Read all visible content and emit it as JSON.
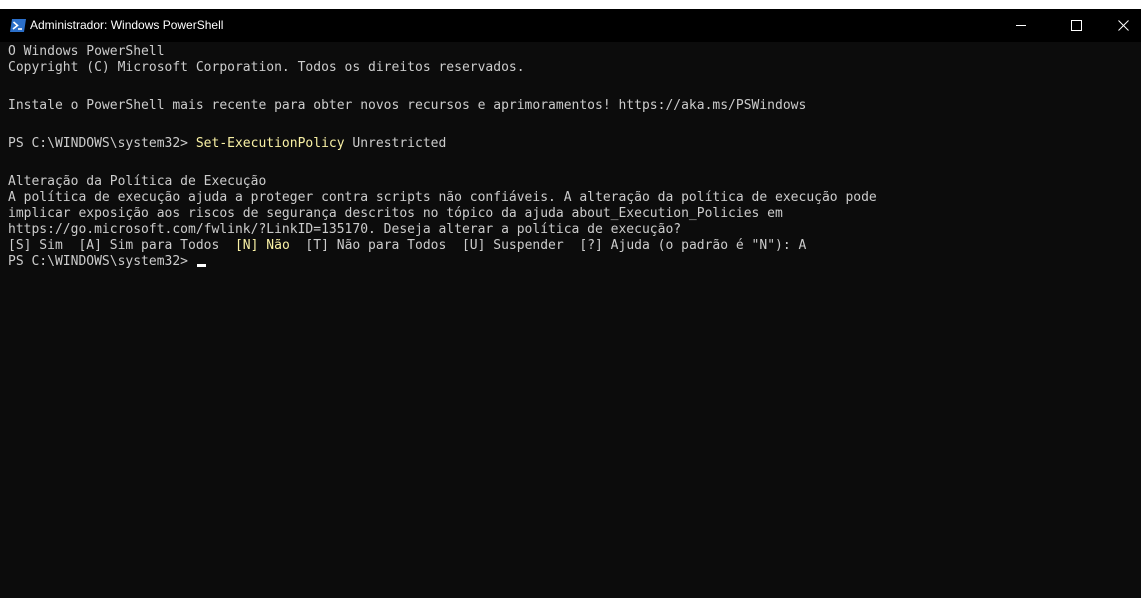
{
  "window": {
    "title": "Administrador: Windows PowerShell",
    "icon": "powershell-icon",
    "controls": [
      "minimize-icon",
      "maximize-icon",
      "close-icon"
    ]
  },
  "colors": {
    "background": "#0c0c0c",
    "text": "#cccccc",
    "command": "#f9f1a5",
    "titlebar": "#000000"
  },
  "console": {
    "banner_1": "O Windows PowerShell",
    "banner_2": "Copyright (C) Microsoft Corporation. Todos os direitos reservados.",
    "banner_3": "Instale o PowerShell mais recente para obter novos recursos e aprimoramentos! https://aka.ms/PSWindows",
    "prompt_1": "PS C:\\WINDOWS\\system32> ",
    "command_1": "Set-ExecutionPolicy",
    "argument_1": " Unrestricted",
    "policy_heading": "Alteração da Política de Execução",
    "policy_text_1": "A política de execução ajuda a proteger contra scripts não confiáveis. A alteração da política de execução pode",
    "policy_text_2": "implicar exposição aos riscos de segurança descritos no tópico da ajuda about_Execution_Policies em",
    "policy_text_3": "https://go.microsoft.com/fwlink/?LinkID=135170. Deseja alterar a política de execução?",
    "choices_before": "[S] Sim  [A] Sim para Todos  ",
    "choices_default": "[N] Não",
    "choices_after": "  [T] Não para Todos  [U] Suspender  [?] Ajuda (o padrão é \"N\"): A",
    "prompt_2": "PS C:\\WINDOWS\\system32> "
  }
}
